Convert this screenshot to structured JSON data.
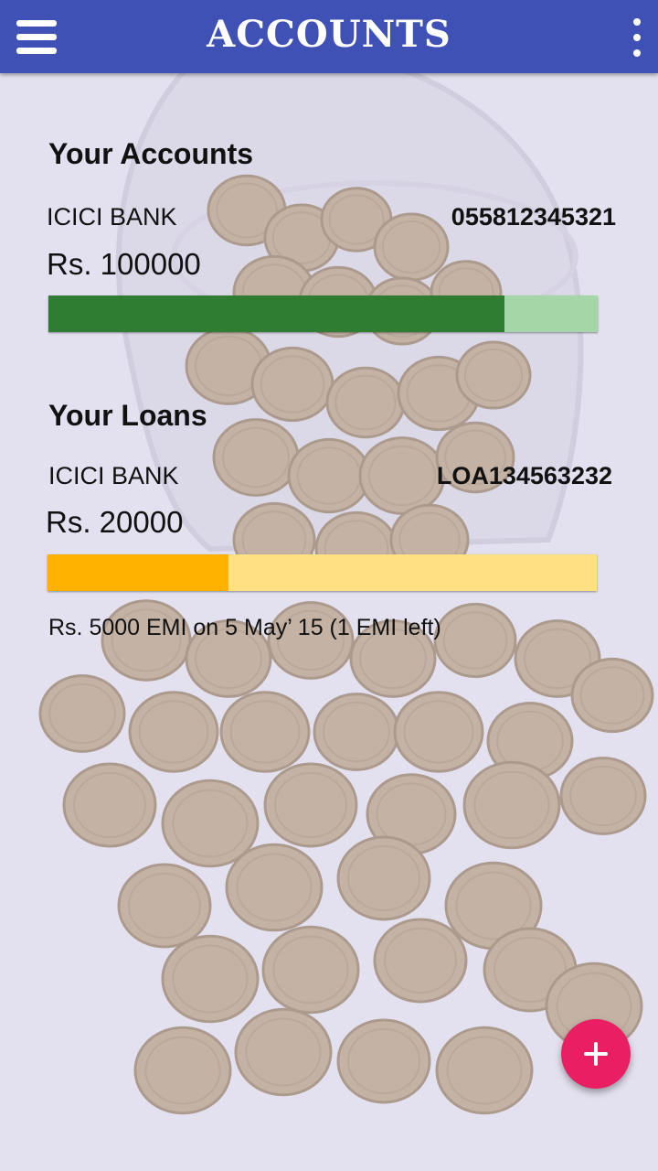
{
  "header": {
    "title": "ACCOUNTS",
    "menu_icon": "hamburger-menu-icon",
    "overflow_icon": "more-vertical-icon"
  },
  "accounts": {
    "heading": "Your Accounts",
    "items": [
      {
        "bank": "ICICI BANK",
        "number": "055812345321",
        "amount": "Rs. 100000",
        "progress": 0.83,
        "fill_color": "#2e7d32",
        "track_color": "#a5d6a7"
      }
    ]
  },
  "loans": {
    "heading": "Your Loans",
    "items": [
      {
        "bank": "ICICI BANK",
        "number": "LOA134563232",
        "amount": "Rs. 20000",
        "progress": 0.33,
        "fill_color": "#ffb300",
        "track_color": "#ffe082",
        "emi_note": "Rs. 5000 EMI on 5 May’ 15 (1 EMI left)"
      }
    ]
  },
  "fab": {
    "icon": "plus-icon",
    "color": "#e91e63"
  },
  "colors": {
    "appbar": "#3f51b5"
  }
}
